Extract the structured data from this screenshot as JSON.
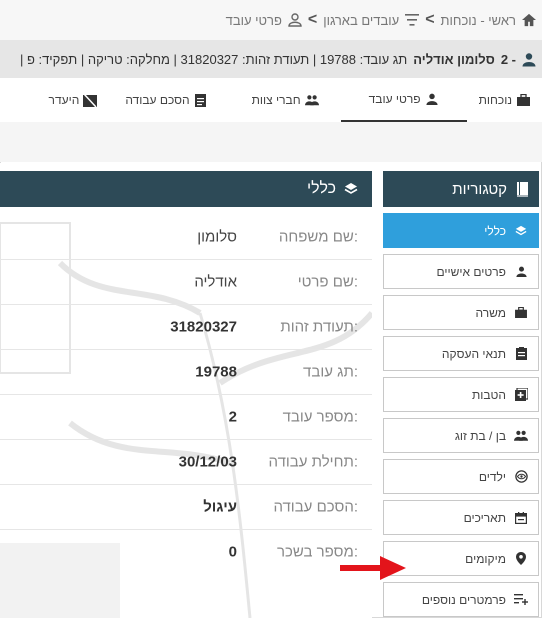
{
  "breadcrumb": {
    "home": "ראשי - נוכחות",
    "level2": "עובדים בארגון",
    "level3": "פרטי עובד"
  },
  "employee_bar": {
    "prefix": "2 -",
    "name": "סלומון אודליה",
    "details": "| תג עובד: 19788 | תעודת זהות: 31820327 | מחלקה: טריקה | תפקיד: פ"
  },
  "tabs": [
    {
      "label": "נוכחות"
    },
    {
      "label": "פרטי עובד"
    },
    {
      "label": "חברי צוות"
    },
    {
      "label": "הסכם עבודה"
    },
    {
      "label": "היעדר"
    }
  ],
  "main": {
    "title": "כללי",
    "rows": [
      {
        "label": "שם משפחה:",
        "value": "סלומון"
      },
      {
        "label": "שם פרטי:",
        "value": "אודליה"
      },
      {
        "label": "תעודת זהות:",
        "value": "31820327"
      },
      {
        "label": "תג עובד:",
        "value": "19788"
      },
      {
        "label": "מספר עובד:",
        "value": "2"
      },
      {
        "label": "תחילת עבודה:",
        "value": "30/12/03"
      },
      {
        "label": "הסכם עבודה:",
        "value": "עיגול"
      },
      {
        "label": "מספר בשכר:",
        "value": "0"
      }
    ]
  },
  "sidebar": {
    "title": "קטגוריות",
    "items": [
      {
        "label": "כללי",
        "icon": "layers-icon"
      },
      {
        "label": "פרטים אישיים",
        "icon": "person-icon"
      },
      {
        "label": "משרה",
        "icon": "briefcase-icon"
      },
      {
        "label": "תנאי העסקה",
        "icon": "clipboard-icon"
      },
      {
        "label": "הטבות",
        "icon": "plus-box-icon"
      },
      {
        "label": "בן / בת זוג",
        "icon": "couple-icon"
      },
      {
        "label": "ילדים",
        "icon": "eye-icon"
      },
      {
        "label": "תאריכים",
        "icon": "calendar-icon"
      },
      {
        "label": "מיקומים",
        "icon": "map-marker-icon"
      },
      {
        "label": "פרמטרים נוספים",
        "icon": "list-plus-icon"
      }
    ]
  },
  "colors": {
    "header_dark": "#2d4a57",
    "active_blue": "#2f9fdc",
    "arrow_red": "#e3141b"
  }
}
